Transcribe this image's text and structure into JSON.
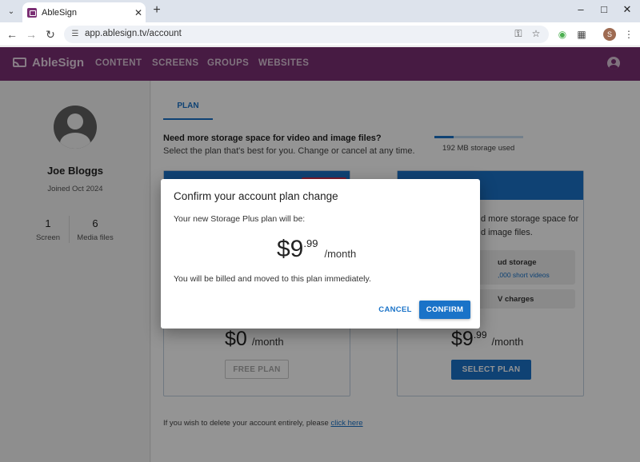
{
  "browser": {
    "tab_title": "AbleSign",
    "url": "app.ablesign.tv/account",
    "profile_initial": "S",
    "icons": {
      "tab_dropdown": "chevron-down-icon",
      "new_tab": "plus-icon",
      "back": "arrow-left-icon",
      "forward": "arrow-right-icon",
      "reload": "reload-icon",
      "site_info": "tune-icon",
      "password": "key-icon",
      "bookmark": "star-icon",
      "extensions": "puzzle-icon",
      "menu": "kebab-menu-icon"
    }
  },
  "app": {
    "brand": "AbleSign",
    "nav": [
      "CONTENT",
      "SCREENS",
      "GROUPS",
      "WEBSITES"
    ],
    "brand_color": "#7b2f74",
    "accent_color": "#1a73c8"
  },
  "profile": {
    "name": "Joe Bloggs",
    "joined": "Joined Oct 2024",
    "stats": [
      {
        "value": "1",
        "label": "Screen"
      },
      {
        "value": "6",
        "label": "Media files"
      }
    ]
  },
  "main": {
    "tab": "PLAN",
    "promo_title": "Need more storage space for video and image files?",
    "promo_subtitle": "Select the plan that's best for you. Change or cancel at any time.",
    "storage_used": "192 MB storage used",
    "storage_fraction": 0.22,
    "free_card": {
      "price_main": "$0",
      "price_unit": "/month",
      "button": "FREE PLAN"
    },
    "plus_card": {
      "desc_line1": "d more storage space for",
      "desc_line2": "d image files.",
      "feature1_title": "ud storage",
      "feature1_sub": ",000 short videos",
      "feature2_title": "V charges",
      "price_main": "$9",
      "price_cents": ".99",
      "price_unit": "/month",
      "button": "SELECT PLAN"
    },
    "delete_prefix": "If you wish to delete your account entirely, please ",
    "delete_link": "click here"
  },
  "dialog": {
    "title": "Confirm your account plan change",
    "line": "Your new Storage Plus plan will be:",
    "price_main": "$9",
    "price_cents": ".99",
    "price_unit": "/month",
    "note": "You will be billed and moved to this plan immediately.",
    "cancel": "CANCEL",
    "confirm": "CONFIRM"
  }
}
